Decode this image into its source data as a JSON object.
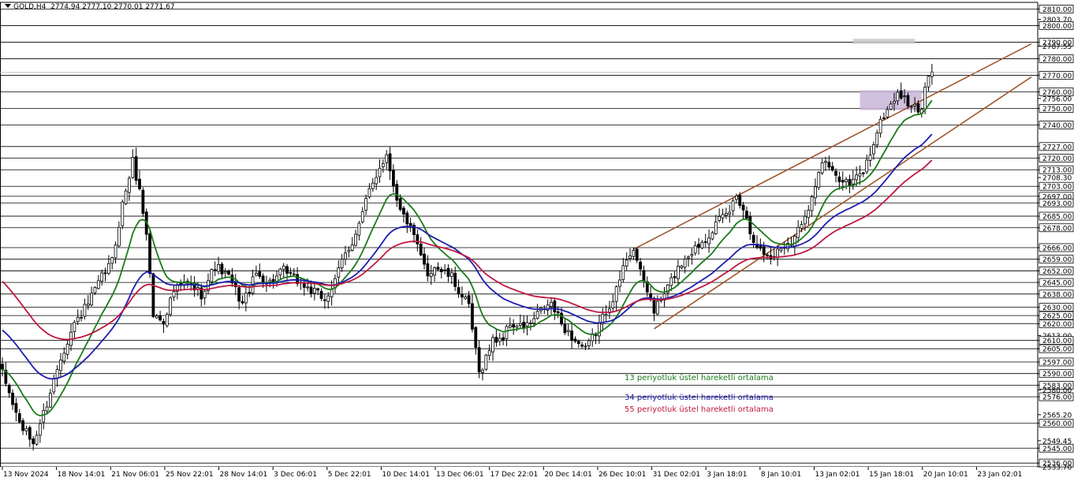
{
  "header": {
    "symbol": "GOLD,H4",
    "ohlc": "2774.94 2777.10 2770.01 2771.67"
  },
  "colors": {
    "ema13": "#1a7a1a",
    "ema34": "#1d1db0",
    "ema55": "#c01840",
    "trend": "#a0562a",
    "candle": "#000000",
    "zone": "#c9b6d8",
    "resistance_zone": "#c8c8c8"
  },
  "legend": [
    {
      "label": "13 periyotluk üstel hareketli ortalama",
      "color": "#1a7a1a"
    },
    {
      "label": "34 periyotluk üstel hareketli ortalama",
      "color": "#1d1db0"
    },
    {
      "label": "55 periyotluk üstel hareketli ortalama",
      "color": "#c01840"
    }
  ],
  "chart_data": {
    "type": "line",
    "chart_style": "candlestick",
    "ylim": [
      2533.7,
      2814.0
    ],
    "y_ticks": [
      "2810.00",
      "2803.70",
      "2800.00",
      "2790.00",
      "2787.55",
      "2780.00",
      "2770.00",
      "2760.00",
      "2756.00",
      "2750.00",
      "2740.00",
      "2727.00",
      "2720.00",
      "2713.00",
      "2708.30",
      "2703.00",
      "2697.00",
      "2693.00",
      "2685.00",
      "2678.00",
      "2666.00",
      "2659.00",
      "2652.00",
      "2645.00",
      "2638.00",
      "2630.00",
      "2625.00",
      "2620.00",
      "2613.00",
      "2610.00",
      "2605.00",
      "2597.00",
      "2590.00",
      "2583.00",
      "2580.00",
      "2576.00",
      "2565.20",
      "2560.00",
      "2549.45",
      "2545.00",
      "2536.00",
      "2533.70"
    ],
    "horizontal_levels": [
      2810,
      2800,
      2790,
      2780,
      2770,
      2760,
      2750,
      2740,
      2727,
      2720,
      2713,
      2703,
      2697,
      2693,
      2685,
      2678,
      2666,
      2659,
      2652,
      2645,
      2638,
      2630,
      2625,
      2620,
      2610,
      2605,
      2597,
      2590,
      2583,
      2576,
      2560,
      2545,
      2536
    ],
    "x_labels": [
      "13 Nov 2024",
      "18 Nov 14:01",
      "21 Nov 06:01",
      "25 Nov 22:01",
      "28 Nov 14:01",
      "3 Dec 06:01",
      "5 Dec 22:01",
      "10 Dec 14:01",
      "13 Dec 06:01",
      "17 Dec 22:01",
      "20 Dec 14:01",
      "26 Dec 10:01",
      "31 Dec 02:01",
      "3 Jan 18:01",
      "8 Jan 10:01",
      "13 Jan 02:01",
      "15 Jan 18:01",
      "20 Jan 10:01",
      "23 Jan 02:01"
    ],
    "close_path": [
      [
        0,
        2590
      ],
      [
        5,
        2560
      ],
      [
        9,
        2548
      ],
      [
        13,
        2572
      ],
      [
        17,
        2600
      ],
      [
        21,
        2620
      ],
      [
        25,
        2632
      ],
      [
        29,
        2648
      ],
      [
        32,
        2658
      ],
      [
        35,
        2692
      ],
      [
        38,
        2718
      ],
      [
        40,
        2700
      ],
      [
        42,
        2675
      ],
      [
        44,
        2625
      ],
      [
        47,
        2622
      ],
      [
        50,
        2640
      ],
      [
        54,
        2645
      ],
      [
        58,
        2638
      ],
      [
        62,
        2655
      ],
      [
        66,
        2648
      ],
      [
        70,
        2632
      ],
      [
        74,
        2650
      ],
      [
        78,
        2645
      ],
      [
        82,
        2652
      ],
      [
        86,
        2646
      ],
      [
        90,
        2640
      ],
      [
        94,
        2635
      ],
      [
        97,
        2645
      ],
      [
        99,
        2658
      ],
      [
        102,
        2670
      ],
      [
        104,
        2680
      ],
      [
        107,
        2700
      ],
      [
        110,
        2715
      ],
      [
        112,
        2722
      ],
      [
        114,
        2705
      ],
      [
        116,
        2688
      ],
      [
        118,
        2682
      ],
      [
        120,
        2672
      ],
      [
        122,
        2660
      ],
      [
        124,
        2650
      ],
      [
        126,
        2655
      ],
      [
        128,
        2652
      ],
      [
        131,
        2648
      ],
      [
        133,
        2640
      ],
      [
        136,
        2630
      ],
      [
        139,
        2590
      ],
      [
        141,
        2600
      ],
      [
        143,
        2610
      ],
      [
        146,
        2612
      ],
      [
        148,
        2620
      ],
      [
        151,
        2618
      ],
      [
        154,
        2620
      ],
      [
        157,
        2628
      ],
      [
        160,
        2632
      ],
      [
        163,
        2620
      ],
      [
        166,
        2612
      ],
      [
        170,
        2604
      ],
      [
        173,
        2615
      ],
      [
        176,
        2628
      ],
      [
        179,
        2640
      ],
      [
        182,
        2660
      ],
      [
        184,
        2666
      ],
      [
        186,
        2650
      ],
      [
        188,
        2640
      ],
      [
        190,
        2628
      ],
      [
        193,
        2638
      ],
      [
        196,
        2650
      ],
      [
        199,
        2660
      ],
      [
        202,
        2666
      ],
      [
        205,
        2672
      ],
      [
        208,
        2680
      ],
      [
        212,
        2688
      ],
      [
        214,
        2698
      ],
      [
        216,
        2690
      ],
      [
        218,
        2676
      ],
      [
        221,
        2664
      ],
      [
        224,
        2660
      ],
      [
        228,
        2668
      ],
      [
        231,
        2672
      ],
      [
        233,
        2682
      ],
      [
        236,
        2696
      ],
      [
        238,
        2712
      ],
      [
        240,
        2718
      ],
      [
        242,
        2710
      ],
      [
        245,
        2708
      ],
      [
        247,
        2704
      ],
      [
        249,
        2708
      ],
      [
        251,
        2712
      ],
      [
        253,
        2723
      ],
      [
        255,
        2736
      ],
      [
        257,
        2746
      ],
      [
        259,
        2752
      ],
      [
        261,
        2760
      ],
      [
        263,
        2755
      ],
      [
        265,
        2752
      ],
      [
        267,
        2748
      ],
      [
        268,
        2752
      ],
      [
        269,
        2760
      ],
      [
        270,
        2770
      ],
      [
        271,
        2772
      ]
    ],
    "bar_count": 272,
    "series": [
      {
        "name": "13 periyotluk üstel hareketli ortalama",
        "period": 13
      },
      {
        "name": "34 periyotluk üstel hareketli ortalama",
        "period": 34
      },
      {
        "name": "55 periyotluk üstel hareketli ortalama",
        "period": 55
      }
    ],
    "trendlines": [
      {
        "from": [
          184,
          2665
        ],
        "to": [
          300,
          2789
        ]
      },
      {
        "from": [
          190,
          2617
        ],
        "to": [
          300,
          2769
        ]
      }
    ],
    "zones": [
      {
        "x_from": 250,
        "x_to": 268,
        "y_from": 2749,
        "y_to": 2761,
        "kind": "support"
      },
      {
        "x_from": 248,
        "x_to": 266,
        "y_from": 2789,
        "y_to": 2792,
        "kind": "resistance"
      }
    ]
  }
}
